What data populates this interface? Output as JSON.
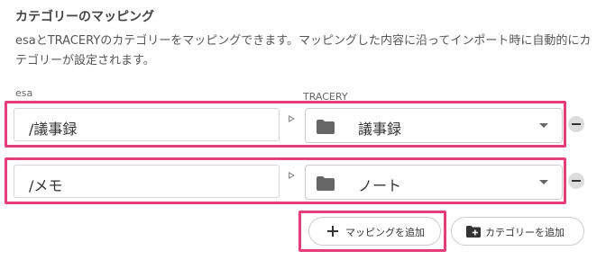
{
  "section": {
    "title": "カテゴリーのマッピング",
    "description": "esaとTRACERYのカテゴリーをマッピングできます。マッピングした内容に沿ってインポート時に自動的にカテゴリーが設定されます。"
  },
  "columns": {
    "source": "esa",
    "target": "TRACERY"
  },
  "mappings": [
    {
      "source": "/議事録",
      "target": "議事録",
      "target_icon": "folder-icon"
    },
    {
      "source": "/メモ",
      "target": "ノート",
      "target_icon": "folder-icon"
    }
  ],
  "actions": {
    "add_mapping": "マッピングを追加",
    "add_category": "カテゴリーを追加"
  },
  "icons": {
    "remove": "minus-circle-icon",
    "arrow": "triangle-right-icon",
    "add": "plus-icon",
    "add_category": "folder-plus-icon",
    "dropdown": "caret-down-icon"
  },
  "colors": {
    "highlight": "#e63e7a",
    "icon": "#666666"
  }
}
